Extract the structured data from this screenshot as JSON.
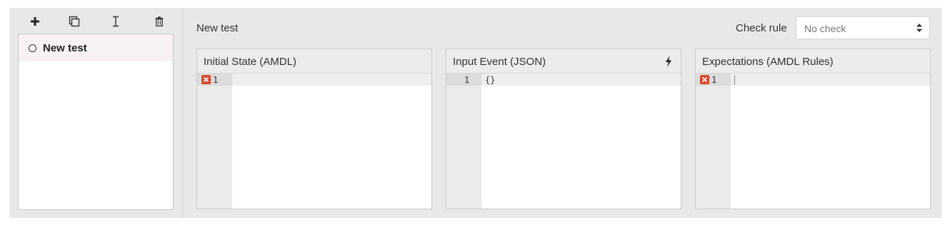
{
  "sidebar": {
    "toolbar": [
      {
        "icon": "plus-icon",
        "label": "Add test"
      },
      {
        "icon": "duplicate-icon",
        "label": "Duplicate test"
      },
      {
        "icon": "rename-cursor-icon",
        "label": "Rename test"
      },
      {
        "icon": "trash-icon",
        "label": "Delete test"
      }
    ],
    "tests": [
      {
        "name": "New test",
        "selected": false
      }
    ]
  },
  "main": {
    "title": "New test",
    "check_rule": {
      "label": "Check rule",
      "value": "No check"
    },
    "panels": [
      {
        "title": "Initial State (AMDL)",
        "lines": [
          {
            "number": "1",
            "text": "",
            "error": true
          }
        ]
      },
      {
        "title": "Input Event (JSON)",
        "action_icon": "bolt-icon",
        "lines": [
          {
            "number": "1",
            "text": "{}",
            "error": false
          }
        ]
      },
      {
        "title": "Expectations (AMDL Rules)",
        "lines": [
          {
            "number": "1",
            "text": "",
            "error": true
          }
        ]
      }
    ]
  },
  "colors": {
    "background": "#e8e8e8",
    "error_marker": "#d9472b",
    "selected_item": "#f7f1f1"
  }
}
